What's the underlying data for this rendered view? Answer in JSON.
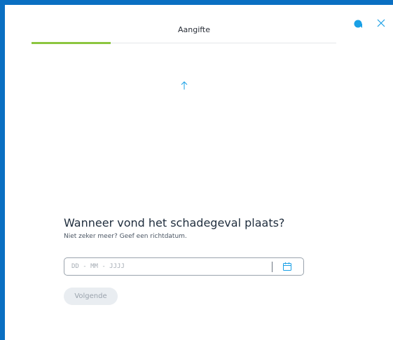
{
  "header": {
    "title": "Aangifte",
    "progress_percent": 26
  },
  "icons": {
    "help": "help-dot-icon",
    "close": "close-icon",
    "up_arrow": "arrow-up-icon",
    "calendar": "calendar-icon"
  },
  "colors": {
    "accent": "#1aa0e6",
    "progress": "#8cc63f",
    "frame": "#0a6fc2"
  },
  "form": {
    "question": "Wanneer vond het schadegeval plaats?",
    "hint": "Niet zeker meer? Geef een richtdatum.",
    "date_placeholder": "DD - MM - JJJJ",
    "date_value": "",
    "next_label": "Volgende"
  }
}
